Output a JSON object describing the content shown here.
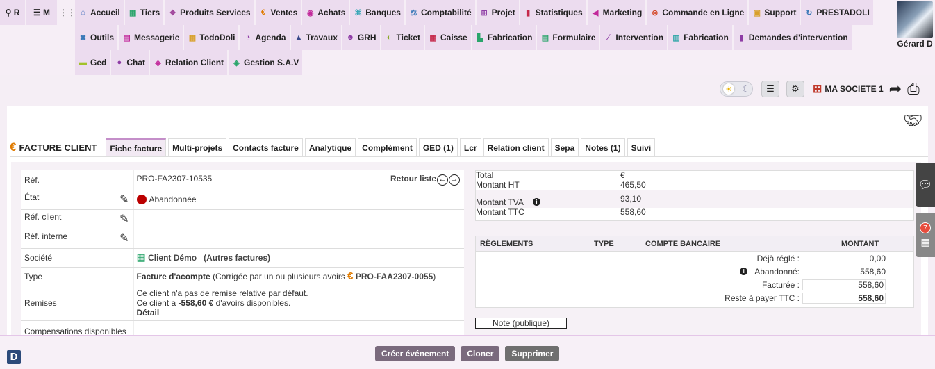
{
  "quick": {
    "search": "R",
    "menu": "M"
  },
  "menu_row1": [
    {
      "label": "Accueil",
      "icon": "home-icon",
      "glyph": "⌂",
      "color": "#5b7fc4"
    },
    {
      "label": "Tiers",
      "icon": "building-icon",
      "glyph": "▦",
      "color": "#2aa56b"
    },
    {
      "label": "Produits Services",
      "icon": "cube-icon",
      "glyph": "❖",
      "color": "#a2499d"
    },
    {
      "label": "Ventes",
      "icon": "euro-icon",
      "glyph": "€",
      "color": "#e07b00"
    },
    {
      "label": "Achats",
      "icon": "coins-icon",
      "glyph": "◉",
      "color": "#c2299b"
    },
    {
      "label": "Banques",
      "icon": "bank-icon",
      "glyph": "⌘",
      "color": "#3aa7b8"
    },
    {
      "label": "Comptabilité",
      "icon": "scale-icon",
      "glyph": "⚖",
      "color": "#3a79b8"
    },
    {
      "label": "Projet",
      "icon": "sitemap-icon",
      "glyph": "⊞",
      "color": "#8e3ca5"
    },
    {
      "label": "Statistiques",
      "icon": "chart-icon",
      "glyph": "▮",
      "color": "#c5284a"
    },
    {
      "label": "Marketing",
      "icon": "bullhorn-icon",
      "glyph": "◀",
      "color": "#c2299b"
    },
    {
      "label": "Commande en Ligne",
      "icon": "commande-icon",
      "glyph": "⊗",
      "color": "#d44a2a"
    },
    {
      "label": "Support",
      "icon": "briefcase-icon",
      "glyph": "▣",
      "color": "#d8a02a"
    },
    {
      "label": "PRESTADOLI",
      "icon": "sync-icon",
      "glyph": "↻",
      "color": "#3a79b8"
    }
  ],
  "menu_row2": [
    {
      "label": "Outils",
      "icon": "tools-icon",
      "glyph": "✖",
      "color": "#3a79b8"
    },
    {
      "label": "Messagerie",
      "icon": "inbox-icon",
      "glyph": "▤",
      "color": "#c2299b"
    },
    {
      "label": "TodoDoli",
      "icon": "calendar-check-icon",
      "glyph": "▦",
      "color": "#d8a02a"
    },
    {
      "label": "Agenda",
      "icon": "clock-icon",
      "glyph": "◔",
      "color": "#8e3ca5"
    },
    {
      "label": "Travaux",
      "icon": "road-icon",
      "glyph": "▲",
      "color": "#3a4a8a"
    },
    {
      "label": "GRH",
      "icon": "users-icon",
      "glyph": "☻",
      "color": "#8e3ca5"
    },
    {
      "label": "Ticket",
      "icon": "ticket-icon",
      "glyph": "◐",
      "color": "#8aa92a"
    },
    {
      "label": "Caisse",
      "icon": "cash-register-icon",
      "glyph": "▦",
      "color": "#c5284a"
    },
    {
      "label": "Fabrication",
      "icon": "industry-icon",
      "glyph": "▙",
      "color": "#2aa56b"
    },
    {
      "label": "Formulaire",
      "icon": "form-icon",
      "glyph": "▤",
      "color": "#2aa56b"
    },
    {
      "label": "Intervention",
      "icon": "pen-icon",
      "glyph": "∕",
      "color": "#8e3ca5"
    },
    {
      "label": "Fabrication",
      "icon": "cogs-icon",
      "glyph": "▥",
      "color": "#2aa5a5"
    },
    {
      "label": "Demandes d'intervention",
      "icon": "file-icon",
      "glyph": "▮",
      "color": "#8e3ca5"
    }
  ],
  "menu_row3": [
    {
      "label": "Ged",
      "icon": "folder-icon",
      "glyph": "▬",
      "color": "#a2c22a"
    },
    {
      "label": "Chat",
      "icon": "comments-icon",
      "glyph": "●",
      "color": "#8e3ca5"
    },
    {
      "label": "Relation Client",
      "icon": "handshake-icon",
      "glyph": "◈",
      "color": "#c2299b"
    },
    {
      "label": "Gestion S.A.V",
      "icon": "handshake-sav-icon",
      "glyph": "◈",
      "color": "#2aa56b"
    }
  ],
  "user": {
    "name": "Gérard D"
  },
  "toolbar": {
    "societe": "MA SOCIETE 1"
  },
  "page": {
    "title": "FACTURE CLIENT"
  },
  "tabs": [
    "Fiche facture",
    "Multi-projets",
    "Contacts facture",
    "Analytique",
    "Complément",
    "GED (1)",
    "Lcr",
    "Relation client",
    "Sepa",
    "Notes (1)",
    "Suivi"
  ],
  "fields": {
    "ref_label": "Réf.",
    "ref_value": "PRO-FA2307-10535",
    "retour": "Retour liste",
    "etat_label": "État",
    "etat_value": "Abandonnée",
    "refclient_label": "Réf. client",
    "refinterne_label": "Réf. interne",
    "societe_label": "Société",
    "societe_value": "Client Démo",
    "societe_extra": "(Autres factures)",
    "type_label": "Type",
    "type_value": "Facture d'acompte",
    "type_paren": "(Corrigée par un ou plusieurs avoirs",
    "type_ref": "PRO-FAA2307-0055",
    "type_close": ")",
    "remises_label": "Remises",
    "remises_line1": "Ce client n'a pas de remise relative par défaut.",
    "remises_line2_a": "Ce client a",
    "remises_amount": "-558,60 €",
    "remises_line2_b": "d'avoirs disponibles.",
    "remises_detail": "Détail",
    "compensations_label": "Compensations disponibles"
  },
  "totals": {
    "total_label": "Total",
    "total_value": "€",
    "ht_label": "Montant HT",
    "ht_value": "465,50",
    "tva_label": "Montant TVA",
    "tva_value": "93,10",
    "ttc_label": "Montant TTC",
    "ttc_value": "558,60"
  },
  "reglements": {
    "headers": [
      "RÈGLEMENTS",
      "TYPE",
      "COMPTE BANCAIRE",
      "MONTANT"
    ],
    "deja_label": "Déjà réglé :",
    "deja_value": "0,00",
    "abandonne_label": "Abandonné:",
    "abandonne_value": "558,60",
    "facturee_label": "Facturée :",
    "facturee_value": "558,60",
    "reste_label": "Reste à payer TTC :",
    "reste_value": "558,60"
  },
  "note_publique": "Note (publique)",
  "side": {
    "badge": "7"
  },
  "actions": {
    "create_event": "Créer événement",
    "clone": "Cloner",
    "delete": "Supprimer"
  }
}
